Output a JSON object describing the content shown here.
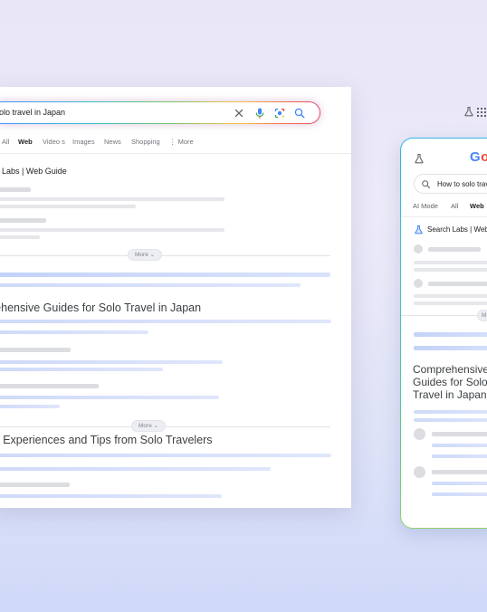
{
  "desktop": {
    "search_query": "olo travel in Japan",
    "tabs": [
      "All",
      "Web",
      "Video s",
      "Images",
      "News",
      "Shopping",
      "⋮ More"
    ],
    "active_tab": "Web",
    "section_title": "ch Labs | Web Guide",
    "more_label": "More ⌄",
    "heading_1": "rehensive Guides for Solo Travel in Japan",
    "heading_2": "al Experiences and Tips from Solo Travelers"
  },
  "mobile": {
    "logo": "Go",
    "search_query": "How to solo trav",
    "tabs": [
      "AI Mode",
      "All",
      "Web"
    ],
    "active_tab": "Web",
    "section_title": "Search Labs | Web",
    "more_label": "M",
    "heading": "Comprehensive Guides for Solo Travel in Japan"
  },
  "colors": {
    "google_blue": "#4285F4",
    "google_red": "#EA4335",
    "placeholder_blue": "#cfdaf9",
    "placeholder_gray": "#e6e7ea"
  },
  "icons": [
    "close-icon",
    "mic-icon",
    "lens-icon",
    "search-icon",
    "labs-flask-icon",
    "apps-grid-icon"
  ]
}
